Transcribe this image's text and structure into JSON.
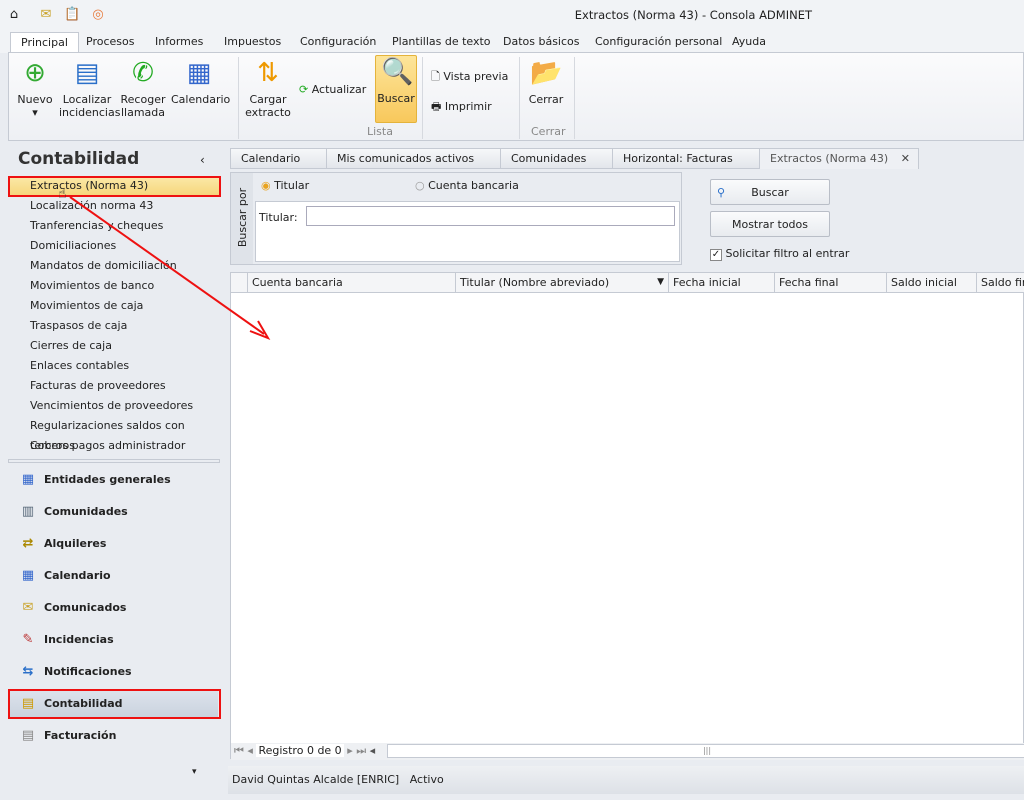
{
  "window": {
    "title": "Extractos (Norma 43) - Consola ADMINET"
  },
  "quick_access": [
    "app-icon",
    "mail-icon",
    "clipboard-icon",
    "signal-icon"
  ],
  "ribbon_tabs": [
    "Principal",
    "Procesos",
    "Informes",
    "Impuestos",
    "Configuración",
    "Plantillas de texto",
    "Datos básicos",
    "Configuración personal",
    "Ayuda"
  ],
  "ribbon": {
    "nuevo": "Nuevo",
    "localizar": [
      "Localizar",
      "incidencias"
    ],
    "recoger": [
      "Recoger",
      "llamada"
    ],
    "calendario": "Calendario",
    "cargar": [
      "Cargar",
      "extracto"
    ],
    "actualizar": "Actualizar",
    "buscar": "Buscar",
    "vista_previa": "Vista previa",
    "imprimir": "Imprimir",
    "cerrar": "Cerrar",
    "group_lista": "Lista",
    "group_cerrar": "Cerrar"
  },
  "sidebar": {
    "title": "Contabilidad",
    "items": [
      "Extractos (Norma 43)",
      "Localización norma 43",
      "Tranferencias y cheques",
      "Domiciliaciones",
      "Mandatos de domiciliación",
      "Movimientos de banco",
      "Movimientos de caja",
      "Traspasos de caja",
      "Cierres de caja",
      "Enlaces contables",
      "Facturas de proveedores",
      "Vencimientos de proveedores",
      "Regularizaciones saldos con terceros",
      "Cobros pagos administrador"
    ],
    "nav": [
      "Entidades generales",
      "Comunidades",
      "Alquileres",
      "Calendario",
      "Comunicados",
      "Incidencias",
      "Notificaciones",
      "Contabilidad",
      "Facturación"
    ]
  },
  "doc_tabs": [
    "Calendario",
    "Mis comunicados activos",
    "Comunidades",
    "Horizontal: Facturas",
    "Extractos (Norma 43)"
  ],
  "filter": {
    "group": "Buscar por",
    "radio_titular": "Titular",
    "radio_cuenta": "Cuenta bancaria",
    "titular_label": "Titular:",
    "titular_value": "",
    "buscar": "Buscar",
    "mostrar_todos": "Mostrar todos",
    "solicitar": "Solicitar filtro al entrar",
    "solicitar_checked": true
  },
  "grid": {
    "columns": [
      "Cuenta bancaria",
      "Titular (Nombre abreviado)",
      "Fecha inicial",
      "Fecha final",
      "Saldo inicial",
      "Saldo final"
    ],
    "record": "Registro 0 de 0"
  },
  "status": {
    "user": "David Quintas Alcalde [ENRIC]",
    "state": "Activo"
  },
  "colors": {
    "annotation": "#e11111",
    "selected": "#f6d57a"
  }
}
